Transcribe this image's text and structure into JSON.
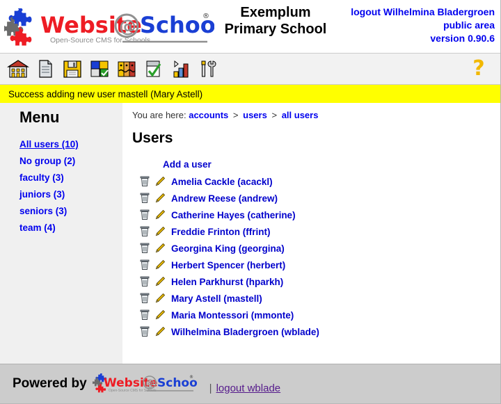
{
  "branding": {
    "logo_name": "Website@School",
    "logo_part1": "Website",
    "logo_at": "@",
    "logo_part2": "School",
    "logo_registered": "®",
    "tagline": "Open-Source CMS for Schools",
    "colors": {
      "red": "#e8161a",
      "blue": "#0033cc",
      "gray": "#808080",
      "yellow_bar": "#ffff00",
      "link_blue": "#0000ee",
      "visited_purple": "#551a8b",
      "help_gold": "#f2b800"
    }
  },
  "header": {
    "school_name_line1": "Exemplum",
    "school_name_line2": "Primary School",
    "logout_label": "logout Wilhelmina Bladergroen",
    "area_label": "public area",
    "version_label": "version 0.90.6"
  },
  "toolbar": {
    "items": [
      {
        "name": "school-icon",
        "title": "School"
      },
      {
        "name": "page-icon",
        "title": "Pages"
      },
      {
        "name": "floppy-disk-icon",
        "title": "Save / Areas"
      },
      {
        "name": "puzzle-modules-icon",
        "title": "Modules"
      },
      {
        "name": "users-faces-icon",
        "title": "Accounts"
      },
      {
        "name": "checkmark-clipboard-icon",
        "title": "Tasks"
      },
      {
        "name": "bar-chart-icon",
        "title": "Statistics"
      },
      {
        "name": "tools-icon",
        "title": "Tools"
      }
    ],
    "help_label": "?"
  },
  "message": {
    "text": "Success adding new user mastell (Mary Astell)",
    "type": "success"
  },
  "sidebar": {
    "title": "Menu",
    "items": [
      {
        "label": "All users (10)",
        "active": true
      },
      {
        "label": "No group (2)",
        "active": false
      },
      {
        "label": "faculty (3)",
        "active": false
      },
      {
        "label": "juniors (3)",
        "active": false
      },
      {
        "label": "seniors (3)",
        "active": false
      },
      {
        "label": "team (4)",
        "active": false
      }
    ]
  },
  "breadcrumb": {
    "prefix": "You are here:",
    "items": [
      "accounts",
      "users",
      "all users"
    ],
    "separator": ">"
  },
  "main": {
    "title": "Users",
    "add_user_label": "Add a user",
    "users": [
      {
        "label": "Amelia Cackle (acackl)"
      },
      {
        "label": "Andrew Reese (andrew)"
      },
      {
        "label": "Catherine Hayes (catherine)"
      },
      {
        "label": "Freddie Frinton (ffrint)"
      },
      {
        "label": "Georgina King (georgina)"
      },
      {
        "label": "Herbert Spencer (herbert)"
      },
      {
        "label": "Helen Parkhurst (hparkh)"
      },
      {
        "label": "Mary Astell (mastell)"
      },
      {
        "label": "Maria Montessori (mmonte)"
      },
      {
        "label": "Wilhelmina Bladergroen (wblade)"
      }
    ],
    "row_icons": {
      "delete": "trash-icon",
      "edit": "pencil-icon"
    }
  },
  "footer": {
    "powered_by_label": "Powered by",
    "separator": "|",
    "logout_label": "logout wblade"
  }
}
